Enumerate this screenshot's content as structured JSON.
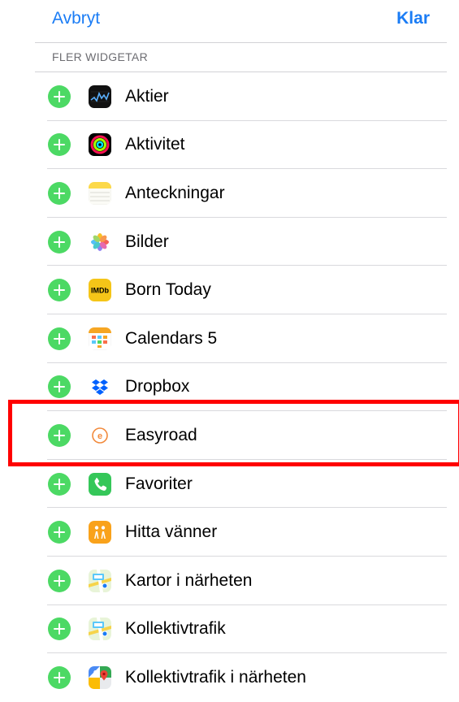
{
  "colors": {
    "tint": "#1a7cf5",
    "add_green": "#4cd964",
    "header_text": "#6d6d72",
    "highlight": "#ff0000"
  },
  "nav": {
    "cancel_label": "Avbryt",
    "done_label": "Klar"
  },
  "section": {
    "header": "FLER WIDGETAR"
  },
  "widgets": [
    {
      "label": "Aktier",
      "icon": "stocks-icon"
    },
    {
      "label": "Aktivitet",
      "icon": "activity-icon"
    },
    {
      "label": "Anteckningar",
      "icon": "notes-icon"
    },
    {
      "label": "Bilder",
      "icon": "photos-icon"
    },
    {
      "label": "Born Today",
      "icon": "imdb-icon",
      "icon_text": "IMDb"
    },
    {
      "label": "Calendars 5",
      "icon": "calendars-icon"
    },
    {
      "label": "Dropbox",
      "icon": "dropbox-icon"
    },
    {
      "label": "Easyroad",
      "icon": "easyroad-icon",
      "icon_text": "e",
      "highlighted": true
    },
    {
      "label": "Favoriter",
      "icon": "phone-icon"
    },
    {
      "label": "Hitta vänner",
      "icon": "find-friends-icon"
    },
    {
      "label": "Kartor i närheten",
      "icon": "maps-icon"
    },
    {
      "label": "Kollektivtrafik",
      "icon": "maps-transit-icon"
    },
    {
      "label": "Kollektivtrafik i närheten",
      "icon": "google-maps-icon"
    }
  ]
}
